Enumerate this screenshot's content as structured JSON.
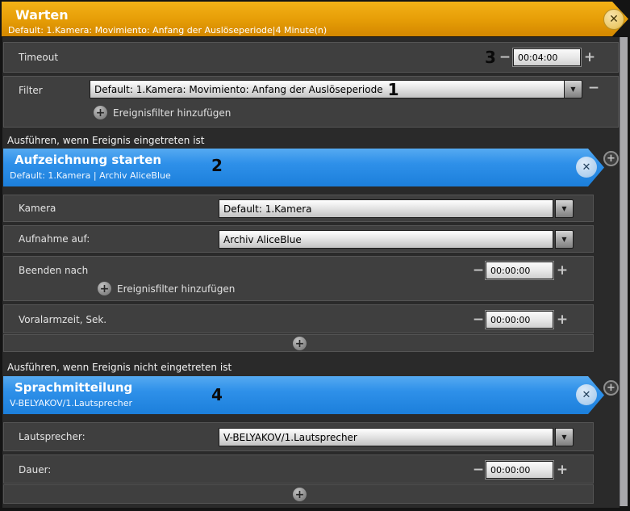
{
  "header": {
    "title": "Warten",
    "subtitle": "Default: 1.Kamera: Movimiento: Anfang der Auslöseperiode|4 Minute(n)"
  },
  "icons": {
    "close": "✕",
    "dropdown_arrow": "▼",
    "plus": "+",
    "minus": "−"
  },
  "timeout": {
    "label": "Timeout",
    "annotation": "3",
    "value": "00:04:00"
  },
  "filter": {
    "label": "Filter",
    "value": "Default: 1.Kamera: Movimiento: Anfang der Auslöseperiode",
    "annotation": "1",
    "add_label": "Ereignisfilter hinzufügen"
  },
  "section1": {
    "label": "Ausführen, wenn Ereignis eingetreten ist",
    "banner": {
      "title": "Aufzeichnung starten",
      "subtitle": "Default: 1.Kamera | Archiv AliceBlue",
      "annotation": "2"
    },
    "kamera": {
      "label": "Kamera",
      "value": "Default: 1.Kamera"
    },
    "aufnahme": {
      "label": "Aufnahme auf:",
      "value": "Archiv AliceBlue"
    },
    "beenden": {
      "label": "Beenden nach",
      "value": "00:00:00",
      "add_label": "Ereignisfilter hinzufügen"
    },
    "voralarm": {
      "label": "Voralarmzeit, Sek.",
      "value": "00:00:00"
    }
  },
  "section2": {
    "label": "Ausführen, wenn Ereignis nicht eingetreten ist",
    "banner": {
      "title": "Sprachmitteilung",
      "subtitle": "V-BELYAKOV/1.Lautsprecher",
      "annotation": "4"
    },
    "lautsprecher": {
      "label": "Lautsprecher:",
      "value": "V-BELYAKOV/1.Lautsprecher"
    },
    "dauer": {
      "label": "Dauer:",
      "value": "00:00:00"
    }
  },
  "colors": {
    "header_orange": "#e59c06",
    "banner_blue": "#2289e6",
    "row_gray": "#3f3f3f",
    "body_gray": "#2a2a2a",
    "scroll_strip": "#a7a7ab"
  }
}
